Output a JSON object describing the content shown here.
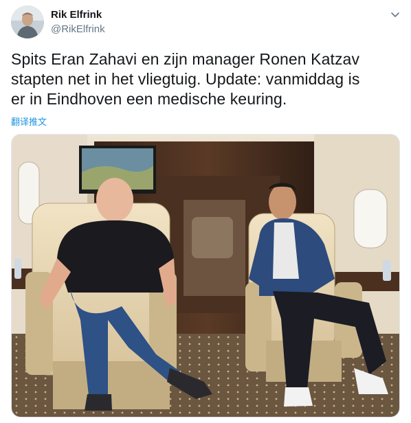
{
  "author": {
    "name": "Rik Elfrink",
    "handle": "@RikElfrink"
  },
  "tweet": {
    "text_lines": [
      "Spits Eran Zahavi en zijn manager Ronen Katzav",
      "stapten net in het vliegtuig. Update: vanmiddag is",
      "er in Eindhoven een medische keuring."
    ],
    "translate_label": "翻译推文"
  },
  "media": {
    "type": "photo",
    "subject": "two-men-seated-in-private-jet-cabin"
  },
  "icons": {
    "caret": "chevron-down-icon",
    "avatar": "profile-photo"
  },
  "colors": {
    "name": "#14171a",
    "handle": "#657786",
    "link": "#1b95e0"
  }
}
